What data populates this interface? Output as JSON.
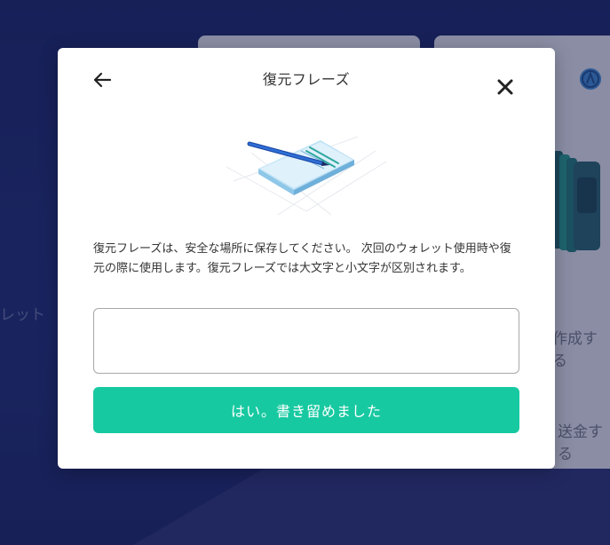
{
  "background": {
    "label_left": "レット",
    "label_right_1": "作成する",
    "label_right_2": "送金する"
  },
  "modal": {
    "title": "復元フレーズ",
    "back_icon": "arrow-left-icon",
    "close_icon": "close-icon",
    "illustration": "notepad-pen-illustration",
    "description": "復元フレーズは、安全な場所に保存してください。 次回のウォレット使用時や復元の際に使用します。復元フレーズでは大文字と小文字が区別されます。",
    "input_value": "",
    "confirm_label": "はい。書き留めました"
  },
  "colors": {
    "accent": "#17c9a1",
    "background": "#1b2566"
  }
}
